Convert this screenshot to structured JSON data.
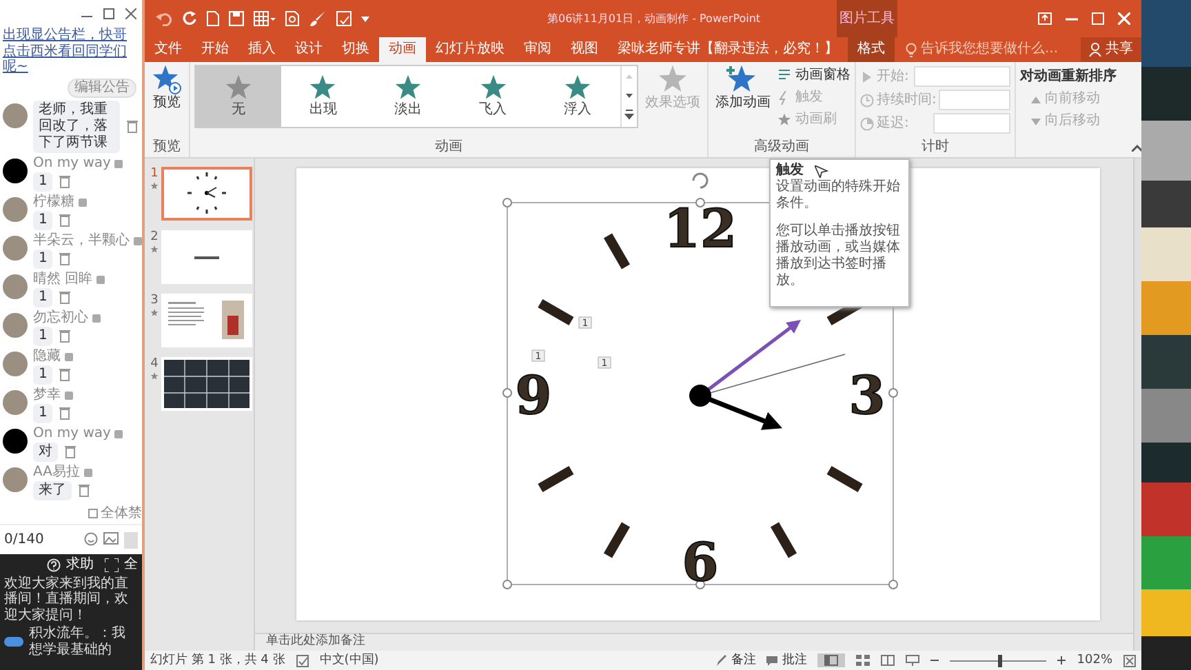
{
  "chat": {
    "announcement": "出现显公告栏，快哥点击西米看回同学们呢~",
    "edit_button": "编辑公告",
    "messages": [
      {
        "text": "老师，我重回改了，落下了两节课",
        "kind": "photo"
      },
      {
        "name": "On my way",
        "text": "1",
        "kind": "dark"
      },
      {
        "name": "柠檬糖",
        "text": "1",
        "kind": "photo"
      },
      {
        "name": "半朵云，半颗心",
        "text": "1",
        "kind": "photo"
      },
      {
        "name": "晴然 回眸",
        "text": "1",
        "kind": "photo"
      },
      {
        "name": "勿忘初心",
        "text": "1",
        "kind": "photo"
      },
      {
        "name": "隐藏",
        "text": "1",
        "kind": "photo"
      },
      {
        "name": "梦幸",
        "text": "1",
        "kind": "photo"
      },
      {
        "name": "On my way",
        "text": "对",
        "kind": "dark"
      },
      {
        "name": "AA易拉",
        "text": "来了",
        "kind": "photo"
      }
    ],
    "mute_all": "全体禁",
    "counter": "0/140",
    "help": "求助",
    "fullscreen": "全",
    "welcome": "欢迎大家来到我的直播间！直播期间，欢迎大家提问！",
    "last_message": "积水流年。：我想学最基础的"
  },
  "window": {
    "title": "第06讲11月01日，动画制作 - PowerPoint",
    "context_header": "图片工具"
  },
  "tabs": [
    {
      "label": "文件",
      "selected": false
    },
    {
      "label": "开始",
      "selected": false
    },
    {
      "label": "插入",
      "selected": false
    },
    {
      "label": "设计",
      "selected": false
    },
    {
      "label": "切换",
      "selected": false
    },
    {
      "label": "动画",
      "selected": true
    },
    {
      "label": "幻灯片放映",
      "selected": false
    },
    {
      "label": "审阅",
      "selected": false
    },
    {
      "label": "视图",
      "selected": false
    },
    {
      "label": "梁咏老师专讲【翻录违法，必究！】",
      "selected": false
    },
    {
      "label": "格式",
      "selected": false,
      "kind": "context"
    }
  ],
  "tell_me": {
    "placeholder": "告诉我您想要做什么..."
  },
  "share": "共享",
  "ribbon": {
    "preview": {
      "label": "预览",
      "group": "预览"
    },
    "gallery": {
      "group": "动画",
      "items": [
        {
          "label": "无",
          "selected": true
        },
        {
          "label": "出现",
          "selected": false
        },
        {
          "label": "淡出",
          "selected": false
        },
        {
          "label": "飞入",
          "selected": false
        },
        {
          "label": "浮入",
          "selected": false
        }
      ]
    },
    "effect_options": {
      "label": "效果选项",
      "disabled": true
    },
    "advanced": {
      "group": "高级动画",
      "add": "添加动画",
      "items": [
        {
          "label": "动画窗格",
          "disabled": false
        },
        {
          "label": "触发",
          "disabled": true
        },
        {
          "label": "动画刷",
          "disabled": true
        }
      ]
    },
    "timing": {
      "group": "计时",
      "fields": [
        {
          "label": "开始:",
          "kind": "dropdown",
          "disabled": true
        },
        {
          "label": "持续时间:",
          "kind": "spin",
          "disabled": true
        },
        {
          "label": "延迟:",
          "kind": "spin",
          "disabled": true
        }
      ]
    },
    "reorder": {
      "title": "对动画重新排序",
      "items": [
        {
          "label": "向前移动",
          "disabled": true
        },
        {
          "label": "向后移动",
          "disabled": true
        }
      ]
    }
  },
  "slides": [
    {
      "number": "1",
      "selected": true,
      "kind": "clock"
    },
    {
      "number": "2",
      "selected": false,
      "kind": "title"
    },
    {
      "number": "3",
      "selected": false,
      "kind": "article"
    },
    {
      "number": "4",
      "selected": false,
      "kind": "grid"
    }
  ],
  "slide": {
    "numbers": [
      "12",
      "3",
      "6",
      "9"
    ],
    "animation_tags": [
      "1",
      "1",
      "1"
    ]
  },
  "tooltip": {
    "title": "触发",
    "lines": [
      "设置动画的特殊开始条件。",
      "您可以单击播放按钮播放动画，或当媒体播放到达书签时播放。"
    ]
  },
  "notes": {
    "placeholder": "单击此处添加备注"
  },
  "status_bar": {
    "slide_info": "幻灯片 第 1 张，共 4 张",
    "language": "中文(中国)",
    "notes": "备注",
    "comments": "批注",
    "zoom": "102%",
    "zoom_level": {
      "level": 0.5
    }
  }
}
